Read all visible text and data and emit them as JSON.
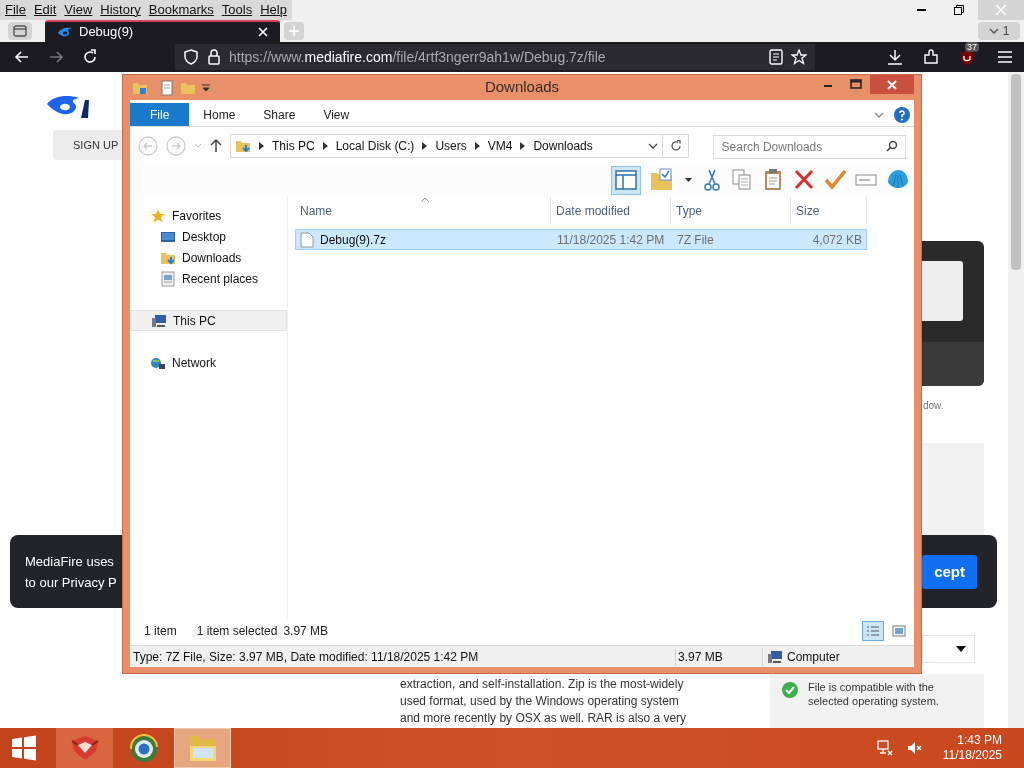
{
  "browser": {
    "menu": [
      "File",
      "Edit",
      "View",
      "History",
      "Bookmarks",
      "Tools",
      "Help"
    ],
    "tab": {
      "title": "Debug(9)"
    },
    "tab_count": "1",
    "url": {
      "scheme": "https://www.",
      "host": "mediafire.com",
      "path": "/file/4rtf3ngerr9ah1w/Debug.7z/file"
    },
    "extension_badge": "37"
  },
  "page": {
    "sign_up": "SIGN UP",
    "note": "dow.",
    "cookie": {
      "lines": [
        "MediaFire uses",
        "to our Privacy P"
      ],
      "button": "cept"
    },
    "description": [
      "extraction, and self-installation. Zip is the most-widely",
      "used format, used by the Windows operating system",
      "and more recently by OSX as well. RAR is also a very"
    ],
    "compatibility": "File is compatible with the selected operating system."
  },
  "explorer": {
    "title": "Downloads",
    "ribbon_tabs": [
      {
        "label": "File",
        "selected": true
      },
      {
        "label": "Home",
        "selected": false
      },
      {
        "label": "Share",
        "selected": false
      },
      {
        "label": "View",
        "selected": false
      }
    ],
    "breadcrumb": [
      "This PC",
      "Local Disk (C:)",
      "Users",
      "VM4",
      "Downloads"
    ],
    "search": {
      "placeholder": "Search Downloads"
    },
    "layout_pane": {
      "on": true
    },
    "nav": [
      {
        "label": "Favorites",
        "kind": "star",
        "selected": false,
        "children": [
          {
            "label": "Desktop",
            "kind": "desktop",
            "selected": false
          },
          {
            "label": "Downloads",
            "kind": "downloads",
            "selected": false
          },
          {
            "label": "Recent places",
            "kind": "recent",
            "selected": false
          }
        ]
      },
      {
        "label": "This PC",
        "kind": "pc",
        "selected": true
      },
      {
        "label": "Network",
        "kind": "network",
        "selected": false
      }
    ],
    "columns": [
      "Name",
      "Date modified",
      "Type",
      "Size"
    ],
    "files": [
      {
        "name": "Debug(9).7z",
        "date": "11/18/2025 1:42 PM",
        "type": "7Z File",
        "size": "4,072 KB",
        "selected": true
      }
    ],
    "status": {
      "count": "1 item",
      "selection": "1 item selected",
      "selection_size": "3.97 MB"
    },
    "views": [
      {
        "kind": "details",
        "selected": true
      },
      {
        "kind": "tiles",
        "selected": false
      }
    ],
    "details": {
      "info": "Type: 7Z File, Size: 3.97 MB, Date modified: 11/18/2025 1:42 PM",
      "size": "3.97 MB",
      "location": "Computer"
    }
  },
  "taskbar": {
    "apps": [
      {
        "kind": "fox",
        "selected": false
      },
      {
        "kind": "globe",
        "selected": false
      },
      {
        "kind": "explorer",
        "selected": true
      }
    ],
    "time": "1:43 PM",
    "date": "11/18/2025"
  }
}
